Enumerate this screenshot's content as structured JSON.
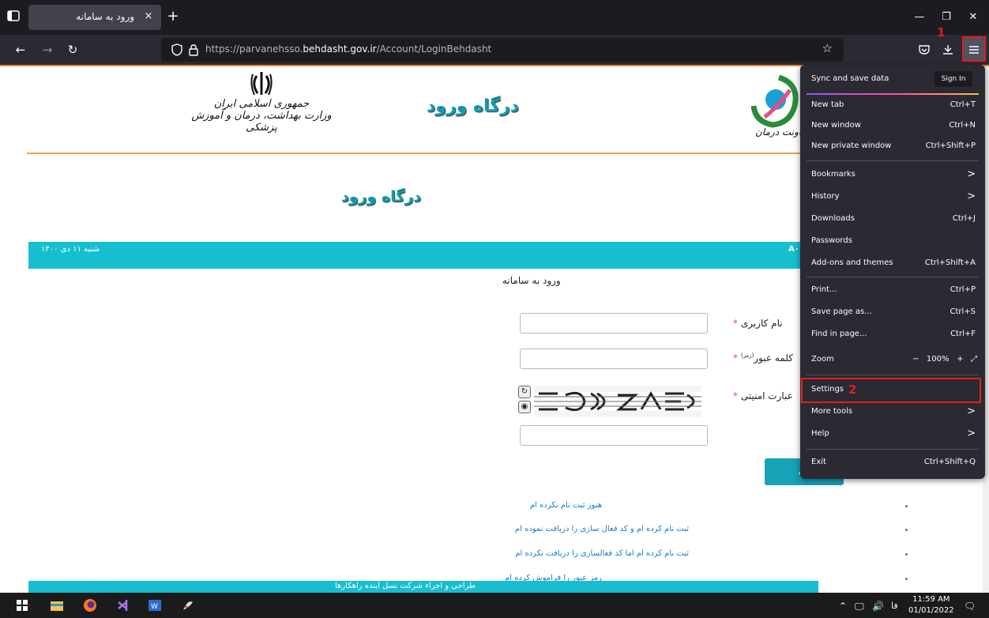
{
  "browser": {
    "tab_title": "ورود به سامانه",
    "tab_close": "×",
    "new_tab": "+",
    "url_prefix": "https://parvanehsso.",
    "url_domain": "behdasht.gov.ir",
    "url_path": "/Account/LoginBehdasht"
  },
  "header": {
    "emblem_line1": "جمهوری اسلامی ایران",
    "emblem_line2": "وزارت بهداشت، درمان و آموزش پزشکی",
    "title": "درگاه ورود",
    "logo_caption": "معاونت درمان"
  },
  "page": {
    "title": "درگاه ورود",
    "date": "شنبه ۱۱ دی ۱۴۰۰",
    "bar_right_fragment": "A۰",
    "login_heading": "ورود به سامانه",
    "username_label": "نام کاربری",
    "password_label": "کلمه عبور",
    "password_hint": "(رمز)",
    "captcha_label": "عبارت امنیتی",
    "required_mark": "*",
    "submit_label": "سامانه",
    "links": [
      "هنوز ثبت نام نکرده ام",
      "ثبت نام کرده ام و کد فعال سازی را دریافت نموده ام",
      "ثبت نام کرده ام اما کد فعالسازی را دریافت نکرده ام",
      "رمز عبور را فراموش کرده ام"
    ],
    "footer": "طراحی و اجراء شرکت نسل آینده راهکارها"
  },
  "menu": {
    "sync": "Sync and save data",
    "signin": "Sign In",
    "items": [
      {
        "label": "New tab",
        "shortcut": "Ctrl+T"
      },
      {
        "label": "New window",
        "shortcut": "Ctrl+N"
      },
      {
        "label": "New private window",
        "shortcut": "Ctrl+Shift+P"
      },
      {
        "label": "Bookmarks",
        "shortcut": ""
      },
      {
        "label": "History",
        "shortcut": ""
      },
      {
        "label": "Downloads",
        "shortcut": "Ctrl+J"
      },
      {
        "label": "Passwords",
        "shortcut": ""
      },
      {
        "label": "Add-ons and themes",
        "shortcut": "Ctrl+Shift+A"
      },
      {
        "label": "Print...",
        "shortcut": "Ctrl+P"
      },
      {
        "label": "Save page as...",
        "shortcut": "Ctrl+S"
      },
      {
        "label": "Find in page...",
        "shortcut": "Ctrl+F"
      },
      {
        "label": "Zoom",
        "shortcut": ""
      },
      {
        "label": "Settings",
        "shortcut": ""
      },
      {
        "label": "More tools",
        "shortcut": ""
      },
      {
        "label": "Help",
        "shortcut": ""
      },
      {
        "label": "Exit",
        "shortcut": "Ctrl+Shift+Q"
      }
    ],
    "zoom_minus": "−",
    "zoom_value": "100%",
    "zoom_plus": "+",
    "arrow": ">"
  },
  "annotations": {
    "step1": "1",
    "step2": "2",
    "color": "#e01f1f"
  },
  "taskbar": {
    "lang": "فا",
    "time": "11:59 AM",
    "date": "01/01/2022",
    "tray_arrow": "^"
  },
  "colors": {
    "teal": "#17bed0",
    "title_teal": "#0c9fb0",
    "menu_bg": "#2b2a33",
    "accent_orange": "#e8883a"
  }
}
